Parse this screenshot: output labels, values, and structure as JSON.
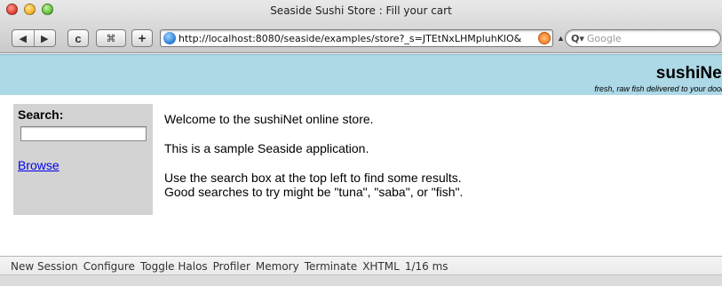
{
  "window": {
    "title": "Seaside Sushi Store : Fill your cart"
  },
  "toolbar": {
    "back_icon": "◀",
    "forward_icon": "▶",
    "reload_icon": "c",
    "snapback_icon": "⌘",
    "add_icon": "+",
    "url": "http://localhost:8080/seaside/examples/store?_s=JTEtNxLHMpluhKlO&",
    "search_placeholder": "Google"
  },
  "header": {
    "brand": "sushiNet",
    "tagline": "fresh, raw fish delivered to your door"
  },
  "sidebar": {
    "search_label": "Search:",
    "search_value": "",
    "browse_link": "Browse"
  },
  "main": {
    "welcome": "Welcome to the sushiNet online store.",
    "sample": "This is a sample Seaside application.",
    "instructions_1": "Use the search box at the top left to find some results.",
    "instructions_2": "Good searches to try might be \"tuna\", \"saba\", or \"fish\"."
  },
  "footer": {
    "links": [
      "New Session",
      "Configure",
      "Toggle Halos",
      "Profiler",
      "Memory",
      "Terminate",
      "XHTML"
    ],
    "timing": "1/16 ms"
  },
  "colors": {
    "header_bg": "#add8e6",
    "sidebar_bg": "#d3d3d3",
    "link": "#0000ee"
  }
}
